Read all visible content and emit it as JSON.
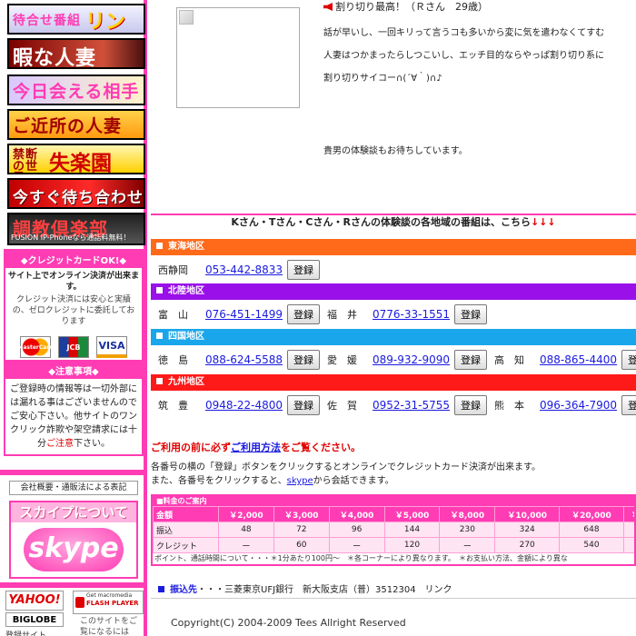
{
  "sidebar": {
    "banners": {
      "wait_small": "待合せ番組",
      "wait_big": "リンク",
      "busy_wife": "暇な人妻",
      "meet_today": "今日会える相手",
      "nearby_wife": "ご近所の人妻",
      "paradise_small": "禁断の世界",
      "paradise_big": "失楽園",
      "meet_now": "今すぐ待ち合わせ",
      "club": "調教倶楽部",
      "club_sub": "FUSION IP-Phoneなら通話料無料！"
    },
    "credit": {
      "title": "◆クレジットカードOK!◆",
      "subtitle": "サイト上でオンライン決済が出来ます。",
      "text": "クレジット決済には安心と実績の、ゼロクレジットに委託しております",
      "card_mc": "MasterCard",
      "card_jcb": "JCB",
      "card_visa": "VISA"
    },
    "notice": {
      "title": "◆注意事項◆",
      "text_before": "ご登録時の情報等は一切外部には漏れる事はございませんのでご安心下さい。他サイトのワンクリック詐欺や架空請求には十分",
      "text_red": "ご注意",
      "text_after": "下さい。"
    },
    "law_link": "会社概要・通販法による表記",
    "skype_title": "スカイプについて",
    "skype_logo": "skype",
    "badges": {
      "yahoo": "YAHOO!",
      "biglobe": "BIGLOBE",
      "biglobe_sub": "登録サイト",
      "flash_top": "Get macromedia",
      "flash_name": "FLASH PLAYER",
      "flash_note": "このサイトをご覧になるには"
    }
  },
  "main": {
    "testimonial": {
      "heading": "割り切り最高！（Ｒさん　29歳）",
      "line1": "話が早いし、一回キリって言うコも多いから変に気を遣わなくてすむ",
      "line2": "人妻はつかまったらしつこいし、エッチ目的ならやっぱ割り切り系に",
      "line3": "割り切りサイコー∩(´∀｀)∩♪",
      "waiting": "貴男の体験談もお待ちしています。"
    },
    "region_intro": "Kさん・Tさん・Cさん・Rさんの体験談の各地域の番組は、こちら",
    "region_intro_arrows": "↓↓↓",
    "regions": [
      {
        "name": "東海地区",
        "rows": [
          {
            "city": "西静岡",
            "phone": "053-442-8833"
          }
        ]
      },
      {
        "name": "北陸地区",
        "rows": [
          {
            "city": "富　山",
            "phone": "076-451-1499"
          },
          {
            "city": "福　井",
            "phone": "0776-33-1551"
          }
        ]
      },
      {
        "name": "四国地区",
        "rows": [
          {
            "city": "徳　島",
            "phone": "088-624-5588"
          },
          {
            "city": "愛　媛",
            "phone": "089-932-9090"
          },
          {
            "city": "高　知",
            "phone": "088-865-4400"
          }
        ]
      },
      {
        "name": "九州地区",
        "rows": [
          {
            "city": "筑　豊",
            "phone": "0948-22-4800"
          },
          {
            "city": "佐　賀",
            "phone": "0952-31-5755"
          },
          {
            "city": "熊　本",
            "phone": "096-364-7900"
          }
        ]
      }
    ],
    "register_label": "登録",
    "usage_before": "ご利用の前に必ず",
    "usage_link": "ご利用方法",
    "usage_after": "をご覧ください。",
    "usage_line1": "各番号の横の「登録」ボタンをクリックするとオンラインでクレジットカード決済が出来ます。",
    "usage_line2_before": "また、各番号をクリックすると、",
    "usage_line2_link": "skype",
    "usage_line2_after": "から会話できます。",
    "price_table": {
      "title": "■料金のご案内",
      "header": [
        "金額",
        "￥2,000",
        "￥3,000",
        "￥4,000",
        "￥5,000",
        "￥8,000",
        "￥10,000",
        "￥20,000",
        "￥30,"
      ],
      "rows": [
        [
          "振込",
          "48",
          "72",
          "96",
          "144",
          "230",
          "324",
          "648",
          "97"
        ],
        [
          "クレジット",
          "ー",
          "60",
          "ー",
          "120",
          "ー",
          "270",
          "540",
          "81"
        ]
      ],
      "footnote": "ポイント、通話時間について・・・＊1分あたり100円〜　＊各コーナーにより異なります。　＊お支払い方法、金額により異な"
    },
    "bank": {
      "label": "振込先",
      "text": "・・・三菱東京UFJ銀行　新大阪支店（普）3512304　リンク"
    },
    "copyright": "Copyright(C) 2004-2009 Tees Allright Reserved"
  },
  "colors": {
    "accent": "#ff3cb4",
    "tokai": "#ff6a1a",
    "hokuriku": "#9a10e8",
    "shikoku": "#1aa6ea",
    "kyushu": "#ff1a1a",
    "link": "#1a1ae0"
  }
}
